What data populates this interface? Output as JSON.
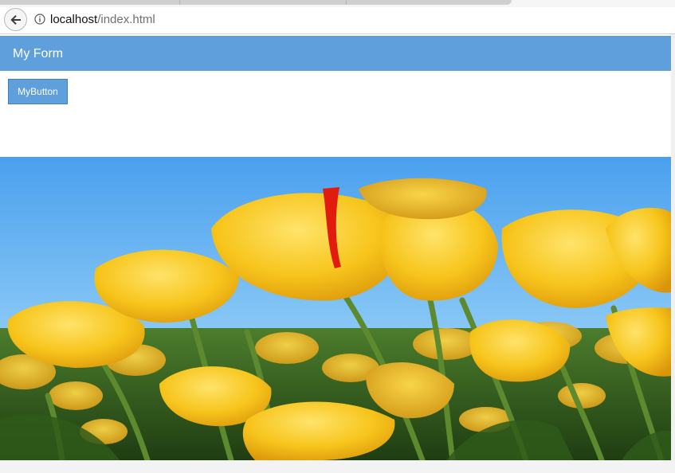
{
  "browser": {
    "url_host": "localhost",
    "url_path": "/index.html",
    "back_icon": "arrow-left-icon",
    "info_icon": "info-circle-icon"
  },
  "page": {
    "form_title": "My Form",
    "button_label": "MyButton",
    "image_subject": "yellow tulips field under blue sky"
  },
  "colors": {
    "header_blue": "#5f9fdc",
    "button_blue": "#5f9fdc",
    "sky_blue": "#6fb4f0",
    "tulip_yellow": "#f5c21a",
    "stem_green": "#4f7a2a"
  }
}
